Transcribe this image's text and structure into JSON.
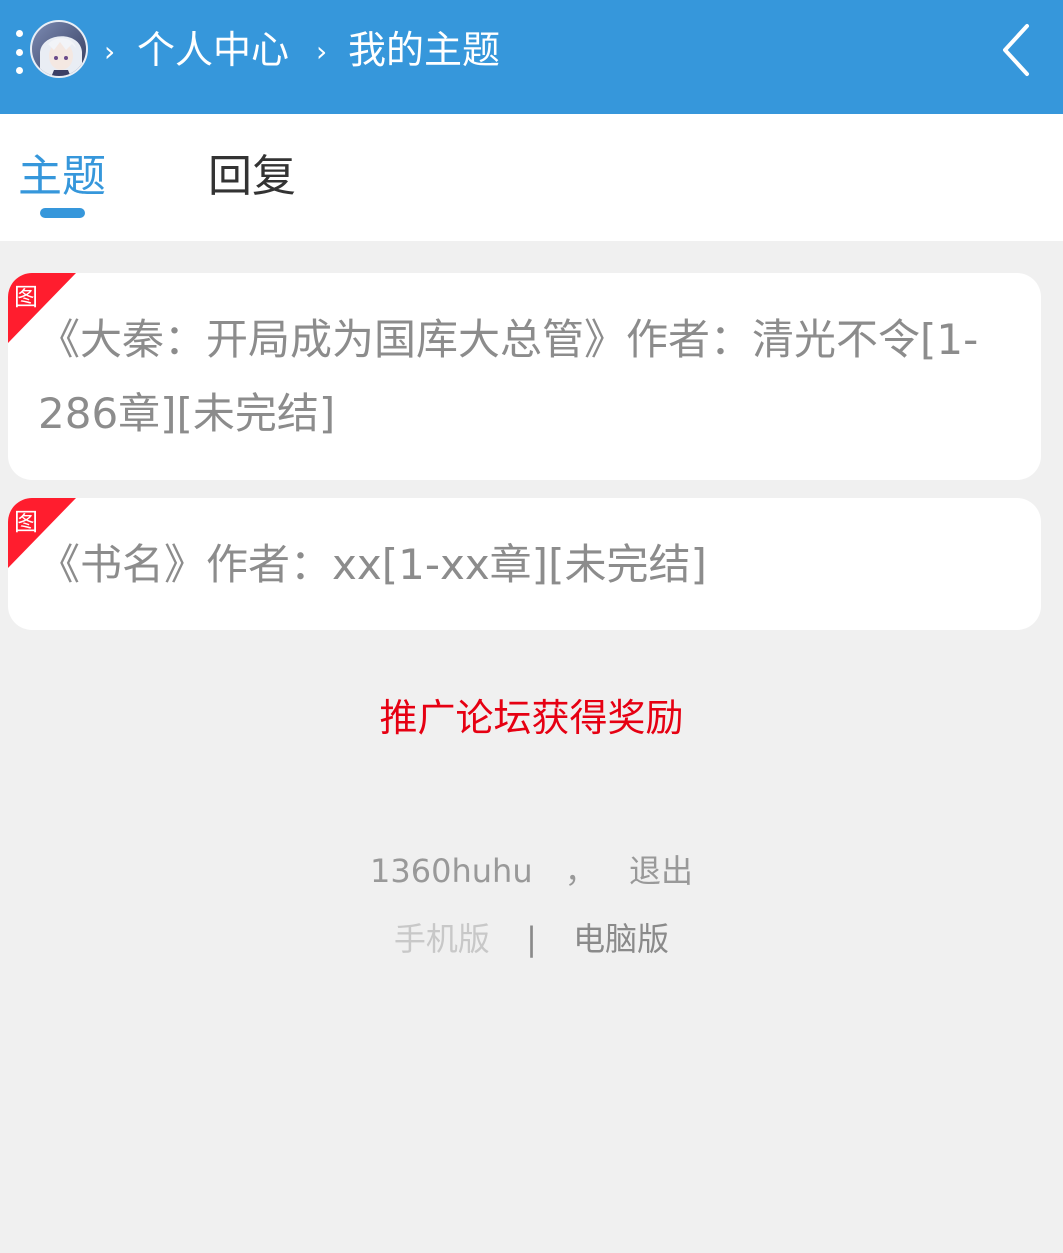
{
  "header": {
    "breadcrumb": [
      {
        "label": "个人中心"
      },
      {
        "label": "我的主题"
      }
    ],
    "separator": "›",
    "background_color": "#3697db"
  },
  "tabs": [
    {
      "label": "主题",
      "active": true
    },
    {
      "label": "回复",
      "active": false
    }
  ],
  "threads": [
    {
      "title": "《大秦：开局成为国库大总管》作者：清光不令[1-286章][未完结]",
      "badge": "图"
    },
    {
      "title": "《书名》作者：xx[1-xx章][未完结]",
      "badge": "图"
    }
  ],
  "promo": {
    "label": "推广论坛获得奖励",
    "color": "#e60012"
  },
  "footer": {
    "username": "1360huhu",
    "comma": "，",
    "logout": "退出",
    "mobile_label": "手机版",
    "divider": "|",
    "desktop_label": "电脑版"
  },
  "icons": {
    "menu": "menu-dots-icon",
    "avatar": "avatar",
    "back": "chevron-left-icon",
    "badge": "image-badge-icon"
  }
}
